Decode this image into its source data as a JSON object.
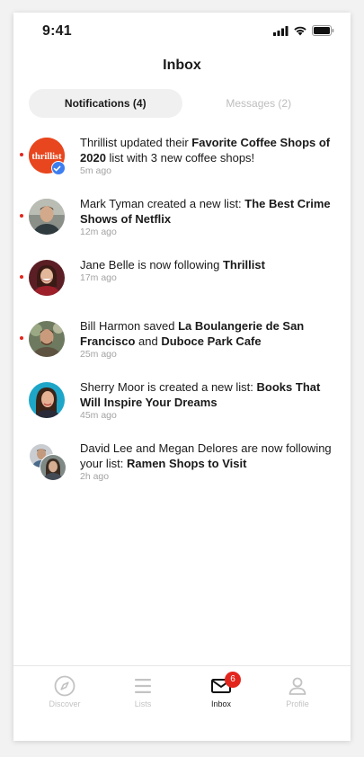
{
  "status_bar": {
    "time": "9:41"
  },
  "header": {
    "title": "Inbox"
  },
  "tabs": [
    {
      "label": "Notifications (4)",
      "active": true
    },
    {
      "label": "Messages (2)",
      "active": false
    }
  ],
  "notifications": [
    {
      "unread": true,
      "avatar_icon": "thrillist-logo",
      "avatar_text": "thrillist",
      "verified": true,
      "parts": [
        "Thrillist updated their ",
        "Favorite Coffee Shops of 2020",
        " list with 3 new coffee shops!"
      ],
      "time": "5m ago"
    },
    {
      "unread": true,
      "avatar_icon": "user-avatar",
      "parts": [
        "Mark Tyman created a new list: ",
        "The Best Crime Shows of Netflix",
        ""
      ],
      "time": "12m ago"
    },
    {
      "unread": true,
      "avatar_icon": "user-avatar",
      "parts": [
        "Jane Belle is now following ",
        "Thrillist",
        ""
      ],
      "time": "17m ago"
    },
    {
      "unread": true,
      "avatar_icon": "user-avatar",
      "parts": [
        "Bill Harmon saved ",
        "La Boulangerie de San Francisco",
        " and ",
        "Duboce Park Cafe",
        ""
      ],
      "time": "25m ago"
    },
    {
      "unread": false,
      "avatar_icon": "user-avatar",
      "parts": [
        "Sherry Moor is created a new list: ",
        "Books That Will Inspire Your Dreams",
        ""
      ],
      "time": "45m ago"
    },
    {
      "unread": false,
      "avatar_icon": "group-avatar",
      "parts": [
        "David Lee and Megan Delores are now following your list: ",
        "Ramen Shops to Visit",
        ""
      ],
      "time": "2h ago"
    }
  ],
  "tab_bar": {
    "items": [
      {
        "label": "Discover",
        "icon": "compass-icon",
        "active": false
      },
      {
        "label": "Lists",
        "icon": "list-icon",
        "active": false
      },
      {
        "label": "Inbox",
        "icon": "mail-icon",
        "active": true,
        "badge": "6"
      },
      {
        "label": "Profile",
        "icon": "user-icon",
        "active": false
      }
    ]
  },
  "colors": {
    "accent": "#e3261d",
    "verified": "#3d7ef0",
    "muted_text": "#a3a3a3",
    "thrillist_brand": "#e8461e"
  }
}
